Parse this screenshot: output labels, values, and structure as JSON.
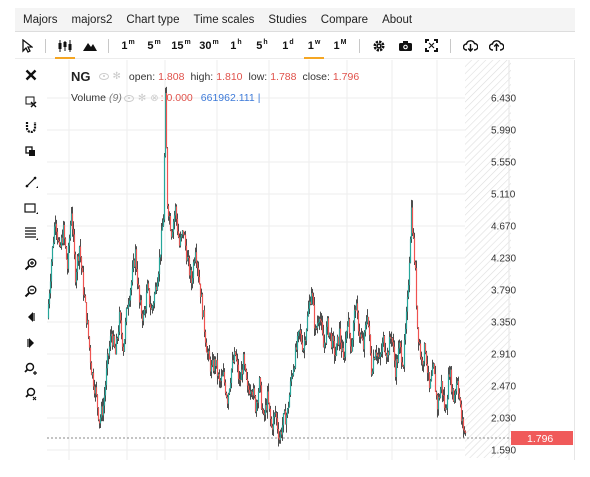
{
  "menu": [
    "Majors",
    "majors2",
    "Chart type",
    "Time scales",
    "Studies",
    "Compare",
    "About"
  ],
  "timescales": [
    {
      "num": "1",
      "unit": "m"
    },
    {
      "num": "5",
      "unit": "m"
    },
    {
      "num": "15",
      "unit": "m"
    },
    {
      "num": "30",
      "unit": "m"
    },
    {
      "num": "1",
      "unit": "h"
    },
    {
      "num": "5",
      "unit": "h"
    },
    {
      "num": "1",
      "unit": "d"
    },
    {
      "num": "1",
      "unit": "w"
    },
    {
      "num": "1",
      "unit": "M"
    }
  ],
  "active_timescale": "1w",
  "legend": {
    "symbol": "NG",
    "open_label": "open:",
    "open": "1.808",
    "high_label": "high:",
    "high": "1.810",
    "low_label": "low:",
    "low": "1.788",
    "close_label": "close:",
    "close": "1.796",
    "volume_label": "Volume",
    "volume_param": "(9)",
    "volume_value": ": 0.000",
    "volume_value2": "661962.111",
    "volume_sep": "|"
  },
  "colors": {
    "up": "#26a69a",
    "down": "#ef5350",
    "price_tag": "#f05a5a",
    "active": "#f5a623"
  },
  "chart_data": {
    "type": "candlestick",
    "symbol": "NG",
    "yticks": [
      "6.430",
      "5.990",
      "5.550",
      "5.110",
      "4.670",
      "4.230",
      "3.790",
      "3.350",
      "2.910",
      "2.470",
      "2.030",
      "1.590"
    ],
    "ylim": [
      1.5,
      6.8
    ],
    "last_price": "1.796",
    "price_path": [
      [
        0,
        3.4
      ],
      [
        4,
        4.2
      ],
      [
        8,
        4.8
      ],
      [
        12,
        4.3
      ],
      [
        16,
        4.6
      ],
      [
        20,
        4.1
      ],
      [
        24,
        4.9
      ],
      [
        28,
        4.0
      ],
      [
        32,
        4.4
      ],
      [
        36,
        3.8
      ],
      [
        40,
        3.3
      ],
      [
        44,
        2.7
      ],
      [
        48,
        2.4
      ],
      [
        52,
        2.0
      ],
      [
        56,
        2.2
      ],
      [
        60,
        2.8
      ],
      [
        64,
        3.2
      ],
      [
        68,
        2.9
      ],
      [
        72,
        3.4
      ],
      [
        76,
        3.0
      ],
      [
        80,
        3.6
      ],
      [
        84,
        3.9
      ],
      [
        88,
        4.3
      ],
      [
        92,
        3.6
      ],
      [
        96,
        3.4
      ],
      [
        100,
        3.8
      ],
      [
        104,
        3.5
      ],
      [
        108,
        3.8
      ],
      [
        112,
        4.2
      ],
      [
        116,
        4.8
      ],
      [
        118,
        6.4
      ],
      [
        120,
        5.0
      ],
      [
        124,
        4.6
      ],
      [
        128,
        4.9
      ],
      [
        132,
        4.4
      ],
      [
        136,
        4.6
      ],
      [
        140,
        4.2
      ],
      [
        144,
        3.9
      ],
      [
        148,
        4.4
      ],
      [
        152,
        3.9
      ],
      [
        156,
        3.4
      ],
      [
        160,
        2.9
      ],
      [
        164,
        2.7
      ],
      [
        168,
        2.8
      ],
      [
        172,
        2.5
      ],
      [
        176,
        2.6
      ],
      [
        180,
        2.3
      ],
      [
        184,
        2.7
      ],
      [
        188,
        2.9
      ],
      [
        192,
        2.5
      ],
      [
        196,
        2.8
      ],
      [
        200,
        2.4
      ],
      [
        204,
        2.5
      ],
      [
        208,
        2.2
      ],
      [
        212,
        2.5
      ],
      [
        216,
        2.0
      ],
      [
        220,
        2.3
      ],
      [
        224,
        1.9
      ],
      [
        228,
        2.1
      ],
      [
        232,
        1.75
      ],
      [
        236,
        2.0
      ],
      [
        240,
        2.1
      ],
      [
        244,
        2.6
      ],
      [
        248,
        2.9
      ],
      [
        252,
        3.2
      ],
      [
        256,
        3.0
      ],
      [
        260,
        3.4
      ],
      [
        264,
        3.8
      ],
      [
        268,
        3.2
      ],
      [
        272,
        3.5
      ],
      [
        276,
        3.0
      ],
      [
        280,
        3.3
      ],
      [
        284,
        3.1
      ],
      [
        288,
        2.9
      ],
      [
        292,
        3.2
      ],
      [
        296,
        2.8
      ],
      [
        300,
        3.4
      ],
      [
        304,
        3.0
      ],
      [
        308,
        3.6
      ],
      [
        312,
        3.2
      ],
      [
        316,
        3.0
      ],
      [
        320,
        3.5
      ],
      [
        324,
        2.7
      ],
      [
        328,
        3.0
      ],
      [
        332,
        2.8
      ],
      [
        336,
        3.1
      ],
      [
        340,
        2.9
      ],
      [
        344,
        3.2
      ],
      [
        348,
        2.7
      ],
      [
        352,
        3.0
      ],
      [
        356,
        2.8
      ],
      [
        360,
        3.6
      ],
      [
        364,
        4.9
      ],
      [
        368,
        4.0
      ],
      [
        370,
        3.3
      ],
      [
        374,
        2.8
      ],
      [
        378,
        3.0
      ],
      [
        382,
        2.4
      ],
      [
        386,
        2.7
      ],
      [
        390,
        2.2
      ],
      [
        394,
        2.5
      ],
      [
        398,
        2.1
      ],
      [
        402,
        2.7
      ],
      [
        406,
        2.3
      ],
      [
        410,
        2.6
      ],
      [
        414,
        2.0
      ],
      [
        418,
        1.8
      ]
    ]
  }
}
